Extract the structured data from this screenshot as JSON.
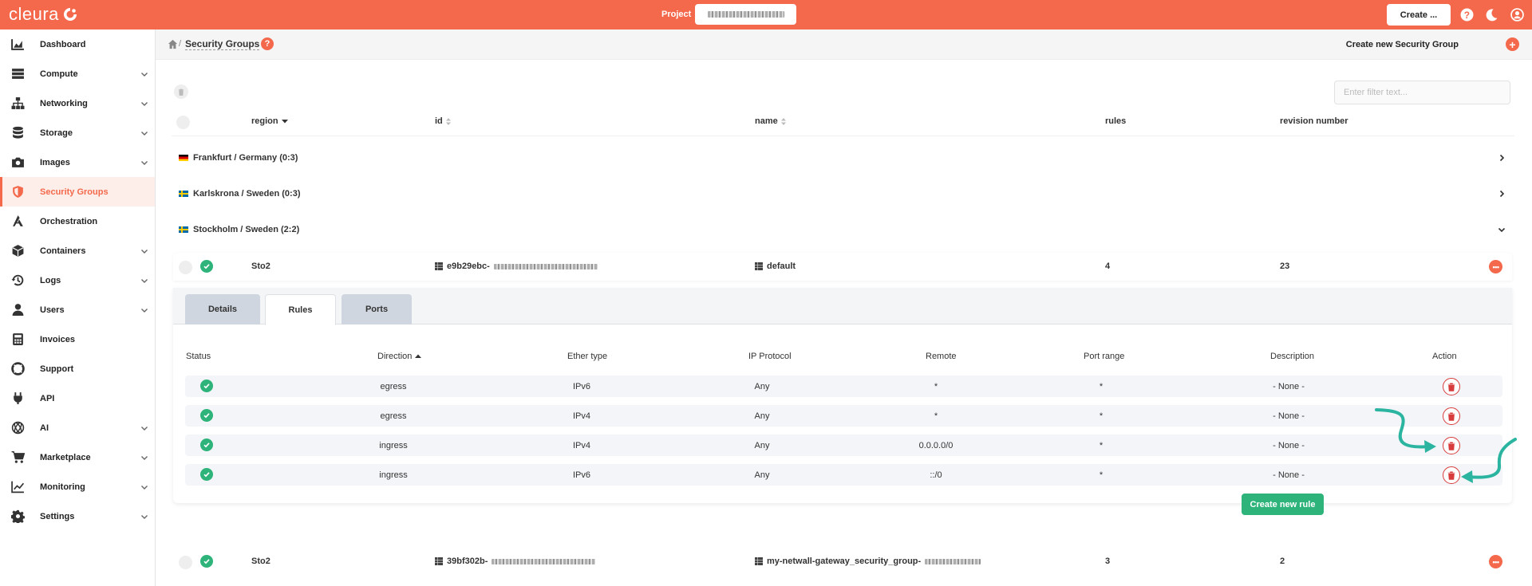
{
  "brand": {
    "name": "cleura"
  },
  "topbar": {
    "project_label": "Project",
    "create_label": "Create ...",
    "icons": [
      "help-icon",
      "moon-icon",
      "user-icon"
    ]
  },
  "sidebar": {
    "items": [
      {
        "label": "Dashboard",
        "icon": "chart-icon",
        "expandable": false
      },
      {
        "label": "Compute",
        "icon": "server-icon",
        "expandable": true
      },
      {
        "label": "Networking",
        "icon": "network-icon",
        "expandable": true
      },
      {
        "label": "Storage",
        "icon": "database-icon",
        "expandable": true
      },
      {
        "label": "Images",
        "icon": "camera-icon",
        "expandable": true
      },
      {
        "label": "Security Groups",
        "icon": "shield-icon",
        "expandable": false,
        "active": true
      },
      {
        "label": "Orchestration",
        "icon": "orchestration-icon",
        "expandable": false
      },
      {
        "label": "Containers",
        "icon": "cube-icon",
        "expandable": true
      },
      {
        "label": "Logs",
        "icon": "history-icon",
        "expandable": true
      },
      {
        "label": "Users",
        "icon": "user-icon",
        "expandable": true
      },
      {
        "label": "Invoices",
        "icon": "calculator-icon",
        "expandable": false
      },
      {
        "label": "Support",
        "icon": "lifebuoy-icon",
        "expandable": false
      },
      {
        "label": "API",
        "icon": "plug-icon",
        "expandable": false
      },
      {
        "label": "AI",
        "icon": "ai-icon",
        "expandable": true
      },
      {
        "label": "Marketplace",
        "icon": "cart-icon",
        "expandable": true
      },
      {
        "label": "Monitoring",
        "icon": "monitoring-icon",
        "expandable": true
      },
      {
        "label": "Settings",
        "icon": "gear-icon",
        "expandable": true
      }
    ]
  },
  "header": {
    "breadcrumb_sep": "/",
    "title": "Security Groups",
    "create_label": "Create new Security Group"
  },
  "table": {
    "filter_placeholder": "Enter filter text...",
    "columns": {
      "region": "region",
      "id": "id",
      "name": "name",
      "rules": "rules",
      "revision": "revision number"
    },
    "regions": [
      {
        "label": "Frankfurt / Germany (0:3)",
        "flag": "de",
        "expanded": false
      },
      {
        "label": "Karlskrona / Sweden (0:3)",
        "flag": "se",
        "expanded": false
      },
      {
        "label": "Stockholm / Sweden (2:2)",
        "flag": "se",
        "expanded": true
      }
    ],
    "groups": [
      {
        "region": "Sto2",
        "id": "e9b29ebc-",
        "name": "default",
        "rules": "4",
        "revision": "23"
      },
      {
        "region": "Sto2",
        "id": "39bf302b-",
        "name": "my-netwall-gateway_security_group-",
        "rules": "3",
        "revision": "2"
      }
    ]
  },
  "panel": {
    "tabs": [
      "Details",
      "Rules",
      "Ports"
    ],
    "active_tab": "Rules",
    "rule_columns": {
      "status": "Status",
      "direction": "Direction",
      "ether": "Ether type",
      "protocol": "IP Protocol",
      "remote": "Remote",
      "port": "Port range",
      "description": "Description",
      "action": "Action"
    },
    "rules": [
      {
        "direction": "egress",
        "ether": "IPv6",
        "protocol": "Any",
        "remote": "*",
        "port": "*",
        "description": "- None -"
      },
      {
        "direction": "egress",
        "ether": "IPv4",
        "protocol": "Any",
        "remote": "*",
        "port": "*",
        "description": "- None -"
      },
      {
        "direction": "ingress",
        "ether": "IPv4",
        "protocol": "Any",
        "remote": "0.0.0.0/0",
        "port": "*",
        "description": "- None -"
      },
      {
        "direction": "ingress",
        "ether": "IPv6",
        "protocol": "Any",
        "remote": "::/0",
        "port": "*",
        "description": "- None -"
      }
    ],
    "create_rule_label": "Create new rule"
  },
  "colors": {
    "brand": "#f4694c",
    "success": "#2eb37a",
    "danger": "#d73b3b",
    "annotation_arrow": "#2bb5a0"
  }
}
